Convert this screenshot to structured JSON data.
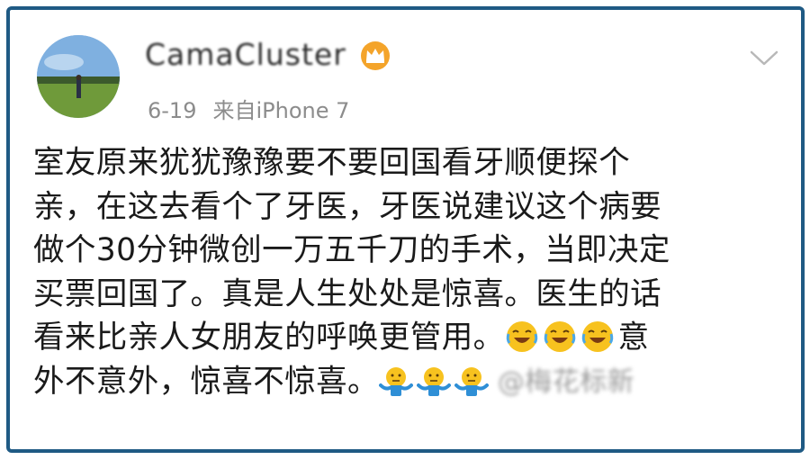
{
  "post": {
    "username": "CamaCluster",
    "date": "6-19",
    "source": "来自iPhone 7",
    "lines": [
      "室友原来犹犹豫豫要不要回国看牙顺便探个",
      "亲，在这去看个了牙医，牙医说建议这个病要",
      "做个30分钟微创一万五千刀的手术，当即决定",
      "买票回国了。真是人生处处是惊喜。医生的话",
      "看来比亲人女朋友的呼唤更管用。",
      "意",
      "外不意外，惊喜不惊喜。"
    ],
    "watermark": "@梅花标新",
    "icons": {
      "verified_badge": "crown-icon",
      "menu": "chevron-down-icon",
      "laugh_emoji": "laughing-tears-emoji-icon",
      "shrug_emoji": "shrug-emoji-icon"
    }
  }
}
